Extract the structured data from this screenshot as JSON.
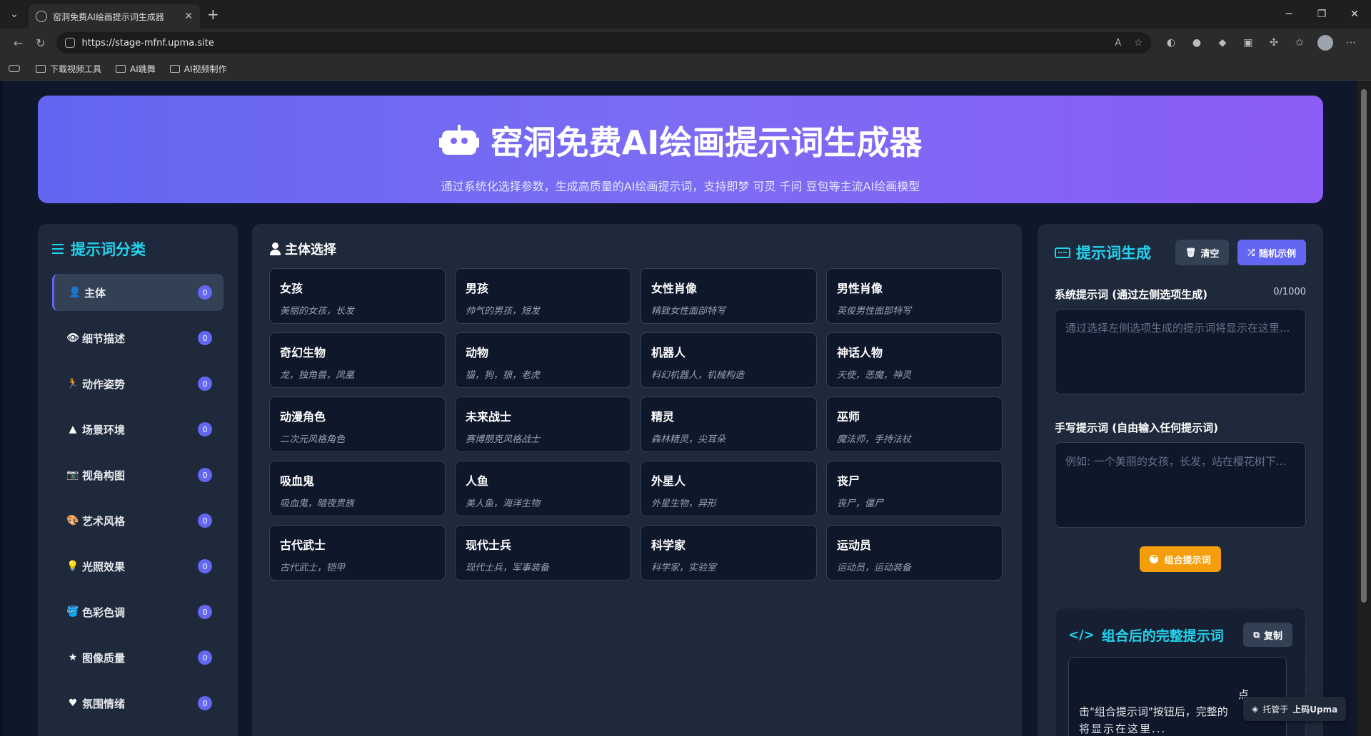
{
  "browser": {
    "tab_title": "窑洞免费AI绘画提示词生成器",
    "url": "https://stage-mfnf.upma.site",
    "bookmarks": [
      "下载视频工具",
      "AI跳舞",
      "AI视频制作"
    ]
  },
  "hero": {
    "title": "窑洞免费AI绘画提示词生成器",
    "subtitle": "通过系统化选择参数，生成高质量的AI绘画提示词，支持即梦 可灵 千问 豆包等主流AI绘画模型"
  },
  "sidebar": {
    "title": "提示词分类",
    "items": [
      {
        "label": "主体",
        "count": "0",
        "icon": "user-icon",
        "glyph": "👤"
      },
      {
        "label": "细节描述",
        "count": "0",
        "icon": "eye-icon",
        "glyph": "👁"
      },
      {
        "label": "动作姿势",
        "count": "0",
        "icon": "running-icon",
        "glyph": "🏃"
      },
      {
        "label": "场景环境",
        "count": "0",
        "icon": "mountain-icon",
        "glyph": "▲"
      },
      {
        "label": "视角构图",
        "count": "0",
        "icon": "camera-icon",
        "glyph": "📷"
      },
      {
        "label": "艺术风格",
        "count": "0",
        "icon": "palette-icon",
        "glyph": "🎨"
      },
      {
        "label": "光照效果",
        "count": "0",
        "icon": "lightbulb-icon",
        "glyph": "💡"
      },
      {
        "label": "色彩色调",
        "count": "0",
        "icon": "paint-bucket-icon",
        "glyph": "🪣"
      },
      {
        "label": "图像质量",
        "count": "0",
        "icon": "star-icon",
        "glyph": "★"
      },
      {
        "label": "氛围情绪",
        "count": "0",
        "icon": "heart-icon",
        "glyph": "♥"
      }
    ]
  },
  "main": {
    "title": "主体选择",
    "cards": [
      {
        "name": "女孩",
        "desc": "美丽的女孩，长发"
      },
      {
        "name": "男孩",
        "desc": "帅气的男孩，短发"
      },
      {
        "name": "女性肖像",
        "desc": "精致女性面部特写"
      },
      {
        "name": "男性肖像",
        "desc": "英俊男性面部特写"
      },
      {
        "name": "奇幻生物",
        "desc": "龙，独角兽，凤凰"
      },
      {
        "name": "动物",
        "desc": "猫，狗，狼，老虎"
      },
      {
        "name": "机器人",
        "desc": "科幻机器人，机械构造"
      },
      {
        "name": "神话人物",
        "desc": "天使，恶魔，神灵"
      },
      {
        "name": "动漫角色",
        "desc": "二次元风格角色"
      },
      {
        "name": "未来战士",
        "desc": "赛博朋克风格战士"
      },
      {
        "name": "精灵",
        "desc": "森林精灵，尖耳朵"
      },
      {
        "name": "巫师",
        "desc": "魔法师，手持法杖"
      },
      {
        "name": "吸血鬼",
        "desc": "吸血鬼，暗夜贵族"
      },
      {
        "name": "人鱼",
        "desc": "美人鱼，海洋生物"
      },
      {
        "name": "外星人",
        "desc": "外星生物，异形"
      },
      {
        "name": "丧尸",
        "desc": "丧尸，僵尸"
      },
      {
        "name": "古代武士",
        "desc": "古代武士，铠甲"
      },
      {
        "name": "现代士兵",
        "desc": "现代士兵，军事装备"
      },
      {
        "name": "科学家",
        "desc": "科学家，实验室"
      },
      {
        "name": "运动员",
        "desc": "运动员，运动装备"
      }
    ]
  },
  "right": {
    "title": "提示词生成",
    "clear_label": "清空",
    "random_label": "随机示例",
    "system_label": "系统提示词 (通过左侧选项生成)",
    "system_count": "0/1000",
    "system_placeholder": "通过选择左侧选项生成的提示词将显示在这里...",
    "manual_label": "手写提示词 (自由输入任何提示词)",
    "manual_placeholder": "例如: 一个美丽的女孩，长发，站在樱花树下...",
    "combine_label": "组合提示词",
    "result_title": "组合后的完整提示词",
    "copy_label": "复制",
    "result_line1": "点",
    "result_line2": "击\"组合提示词\"按钮后，完整的",
    "result_line3": "将显示在这里..."
  },
  "hosted": {
    "prefix": "托管于",
    "brand": "上码Upma"
  }
}
